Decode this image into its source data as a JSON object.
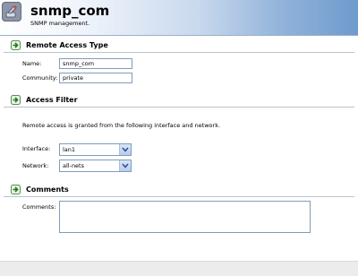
{
  "header": {
    "title": "snmp_com",
    "subtitle": "SNMP management.",
    "icon": "snmp-tool-icon"
  },
  "sections": {
    "remote_access": {
      "heading": "Remote Access Type",
      "icon": "section-arrow-icon"
    },
    "access_filter": {
      "heading": "Access Filter",
      "icon": "section-arrow-icon"
    },
    "comments": {
      "heading": "Comments",
      "icon": "section-arrow-icon"
    }
  },
  "remote_access": {
    "name_label": "Name:",
    "name_value": "snmp_com",
    "community_label": "Community:",
    "community_value": "private"
  },
  "access_filter": {
    "description": "Remote access is granted from the following interface and network.",
    "interface_label": "Interface:",
    "interface_value": "lan1",
    "network_label": "Network:",
    "network_value": "all-nets"
  },
  "comments": {
    "comments_label": "Comments:",
    "comments_value": ""
  },
  "colors": {
    "accent": "#6f9acd",
    "section_arrow": "#3a9a3a",
    "input_border": "#7f9db9"
  }
}
